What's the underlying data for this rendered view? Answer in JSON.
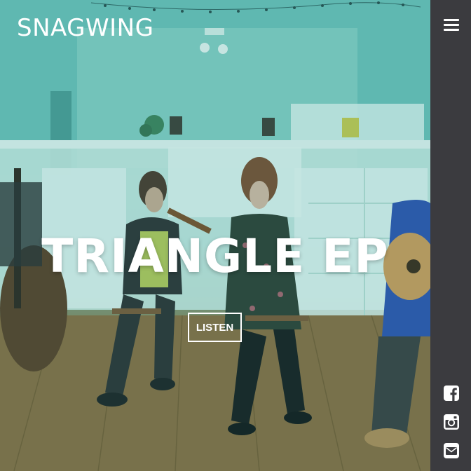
{
  "brand": {
    "name": "SNAGWING"
  },
  "hero": {
    "headline": "TRIANGLE EP",
    "cta_label": "LISTEN"
  },
  "sidebar": {
    "menu_icon": "hamburger-menu-icon",
    "social": [
      {
        "icon": "facebook-icon"
      },
      {
        "icon": "instagram-icon"
      },
      {
        "icon": "email-icon"
      }
    ]
  },
  "colors": {
    "sidebar_bg": "#3b3b3f",
    "overlay_tint": "#3aa6a0",
    "text": "#ffffff"
  }
}
